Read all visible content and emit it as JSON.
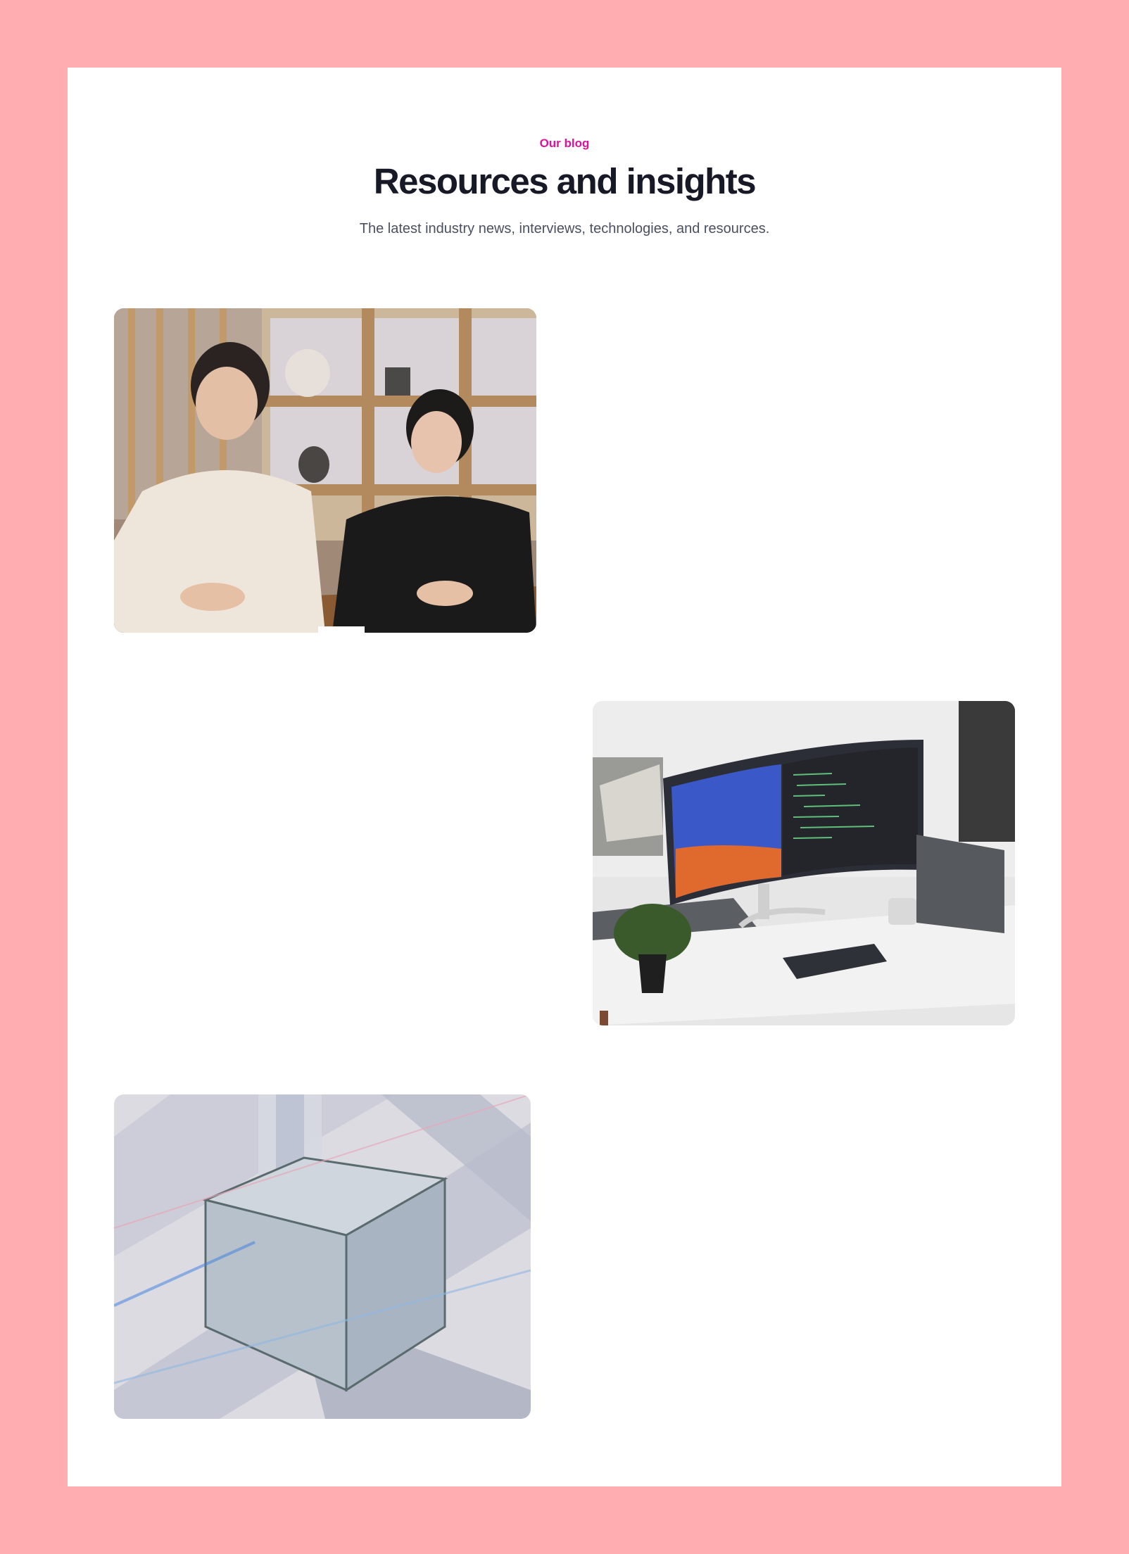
{
  "header": {
    "eyebrow": "Our blog",
    "title": "Resources and insights",
    "subtitle": "The latest industry news, interviews, technologies, and resources."
  },
  "posts": [
    {
      "image_description": "two-people-at-table-photo"
    },
    {
      "image_description": "desk-with-curved-monitor-photo"
    },
    {
      "image_description": "glass-cross-structure-render"
    }
  ],
  "colors": {
    "page_background": "#ffadb0",
    "card_background": "#ffffff",
    "accent": "#e0129a",
    "heading": "#171a26",
    "body_text": "#4a5060"
  }
}
